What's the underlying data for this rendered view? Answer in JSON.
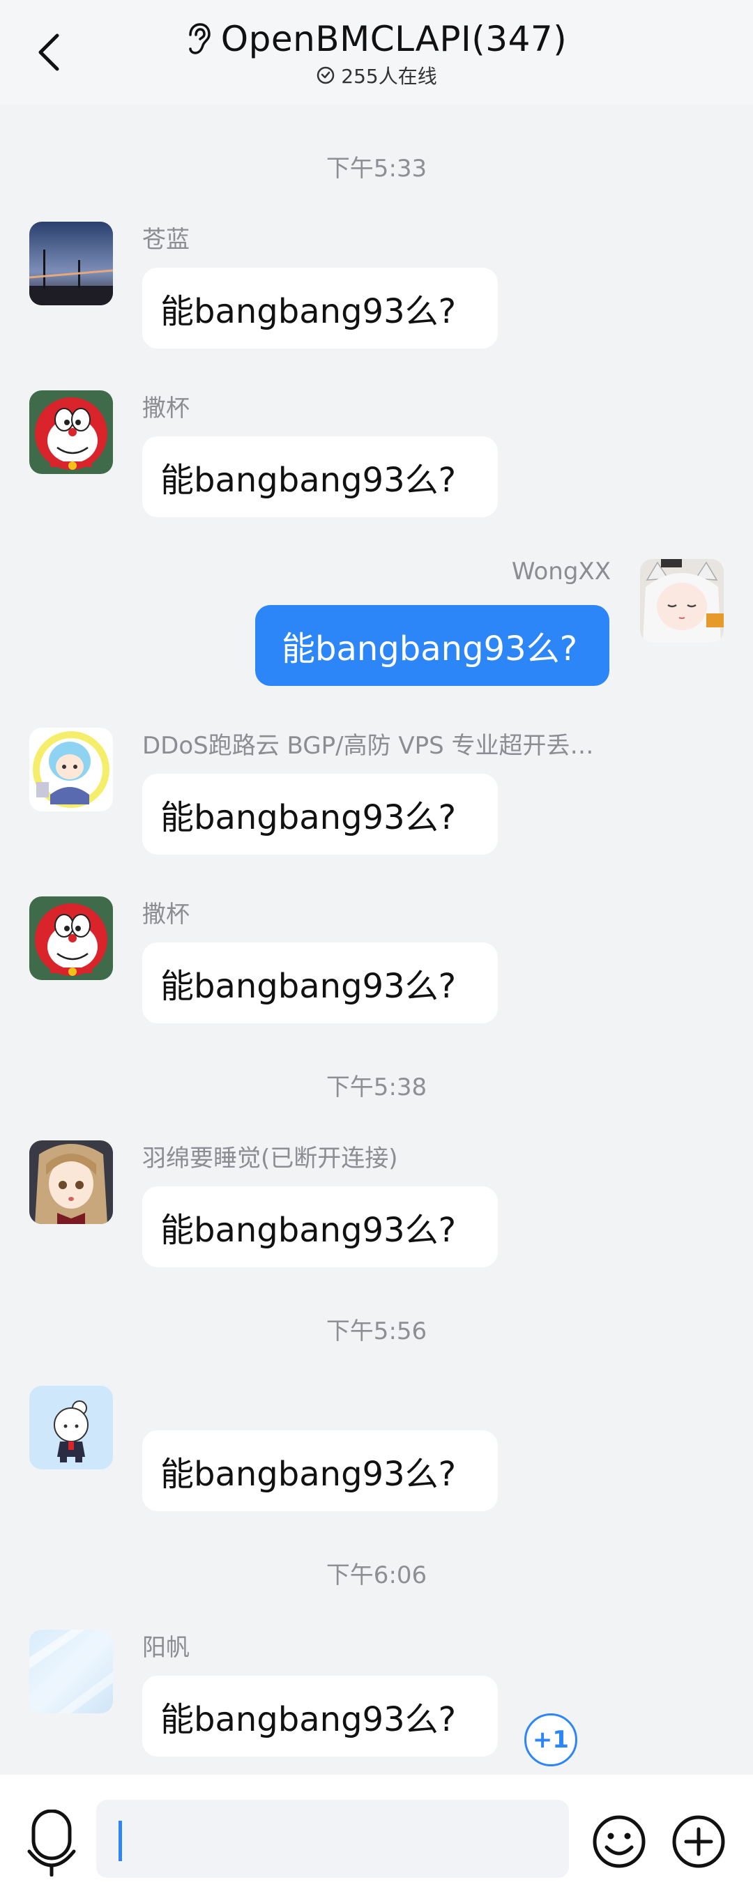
{
  "header": {
    "title": "OpenBMCLAPI(347)",
    "online": "255人在线"
  },
  "chat": {
    "items": [
      {
        "time": "下午5:33"
      },
      {
        "nick": "苍蓝",
        "text": "能bangbang93么?"
      },
      {
        "nick": "撒杯",
        "text": "能bangbang93么?"
      },
      {
        "nick": "WongXX",
        "text": "能bangbang93么?"
      },
      {
        "nick": "DDoS跑路云 BGP/高防 VPS 专业超开丢…",
        "text": "能bangbang93么?"
      },
      {
        "nick": "撒杯",
        "text": "能bangbang93么?"
      },
      {
        "time": "下午5:38"
      },
      {
        "nick": "羽绵要睡觉(已断开连接)",
        "text": "能bangbang93么?"
      },
      {
        "time": "下午5:56"
      },
      {
        "nick": "",
        "text": "能bangbang93么?"
      },
      {
        "time": "下午6:06"
      },
      {
        "nick": "阳帆",
        "text": "能bangbang93么?"
      }
    ],
    "plus_one": "+1"
  },
  "colors": {
    "accent": "#2d86f7",
    "background": "#f2f3f5",
    "bubble": "#ffffff"
  },
  "icons": {
    "back": "chevron-left-icon",
    "ear": "ear-icon",
    "online": "check-circle-icon",
    "mic": "microphone-icon",
    "emoji": "smiley-icon",
    "plus": "plus-circle-icon"
  }
}
